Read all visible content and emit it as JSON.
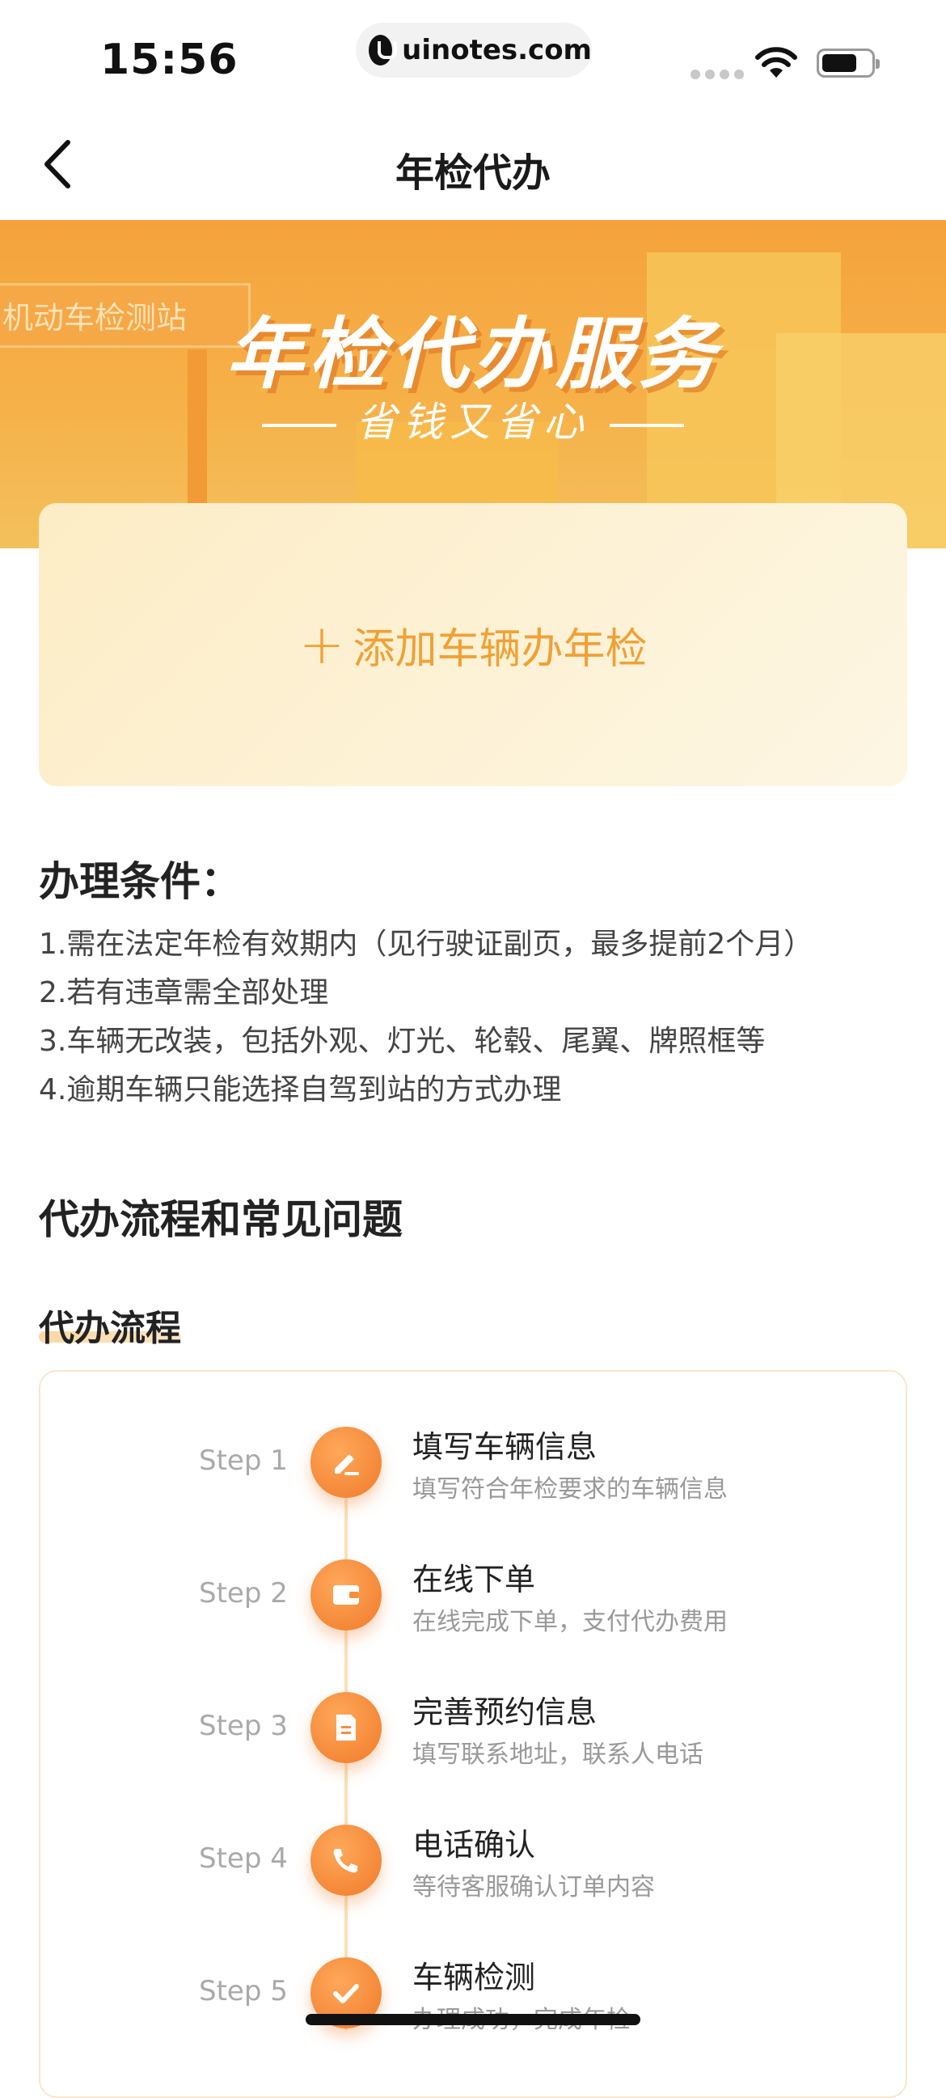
{
  "status_bar": {
    "time": "15:56",
    "url": "uinotes.com"
  },
  "nav": {
    "title": "年检代办"
  },
  "banner": {
    "sign": "机动车检测站",
    "title": "年检代办服务",
    "subtitle": "省钱又省心"
  },
  "add_card": {
    "plus": "+",
    "label": "添加车辆办年检"
  },
  "conditions": {
    "title": "办理条件：",
    "items": [
      "1.需在法定年检有效期内（见行驶证副页，最多提前2个月）",
      "2.若有违章需全部处理",
      "3.车辆无改装，包括外观、灯光、轮毂、尾翼、牌照框等",
      "4.逾期车辆只能选择自驾到站的方式办理"
    ]
  },
  "faq": {
    "title": "代办流程和常见问题"
  },
  "flow": {
    "title": "代办流程",
    "steps": [
      {
        "no": "Step 1",
        "name": "填写车辆信息",
        "desc": "填写符合年检要求的车辆信息",
        "icon": "edit-icon"
      },
      {
        "no": "Step 2",
        "name": "在线下单",
        "desc": "在线完成下单，支付代办费用",
        "icon": "wallet-icon"
      },
      {
        "no": "Step 3",
        "name": "完善预约信息",
        "desc": "填写联系地址，联系人电话",
        "icon": "document-icon"
      },
      {
        "no": "Step 4",
        "name": "电话确认",
        "desc": "等待客服确认订单内容",
        "icon": "phone-icon"
      },
      {
        "no": "Step 5",
        "name": "车辆检测",
        "desc": "办理成功，完成年检",
        "icon": "check-icon"
      }
    ]
  },
  "colors": {
    "accent": "#f0a136",
    "banner": "#f5a23c",
    "step_circle": "#f07a2a"
  }
}
